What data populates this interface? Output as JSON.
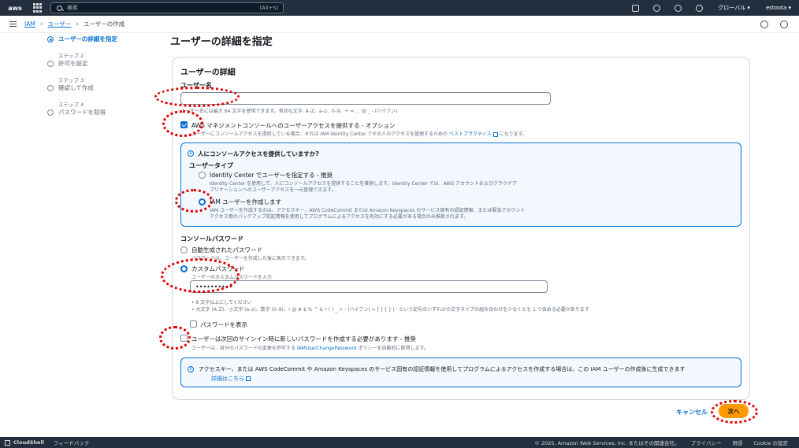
{
  "topnav": {
    "logo": "aws",
    "search_placeholder": "検索",
    "search_shortcut": "[Alt+S]",
    "region": "グローバル ▾",
    "account": "estoota ▾"
  },
  "breadcrumb": {
    "service": "IAM",
    "parent": "ユーザー",
    "current": "ユーザーの作成"
  },
  "steps": [
    {
      "num": "",
      "label": "ユーザーの詳細を指定"
    },
    {
      "num": "ステップ 2",
      "label": "許可を設定"
    },
    {
      "num": "ステップ 3",
      "label": "確認して作成"
    },
    {
      "num": "ステップ 4",
      "label": "パスワードを取得"
    }
  ],
  "page_title": "ユーザーの詳細を指定",
  "card": {
    "title": "ユーザーの詳細",
    "username_label": "ユーザー名",
    "username_hint": "ユーザー名には最大 64 文字を使用できます。有効な文字: A–Z、a–z、0–9、+ = , . @ _ - (ハイフン)",
    "console_access_label": "AWS マネジメントコンソールへのユーザーアクセスを提供する - オプション",
    "console_access_hint": "ユーザーにコンソールアクセスを提供している場合、それは IAM Identity Center でその人のアクセスを管理するための",
    "best_practice_link": "ベストプラクティス",
    "console_access_hint_tail": "になります。",
    "info_title": "人にコンソールアクセスを提供していますか?",
    "user_type_label": "ユーザータイプ",
    "opt_identity_center": "Identity Center でユーザーを指定する - 推奨",
    "opt_identity_center_hint1": "Identity Center を使用して、人にコンソールアクセスを提供することを推奨します。Identity Center では、AWS アカウントおよびクラウドア",
    "opt_identity_center_hint2": "プリケーションへのユーザーアクセスを一元管理できます。",
    "opt_iam_user": "IAM ユーザーを作成します",
    "opt_iam_user_hint1": "IAM ユーザーを作成するのは、アクセスキー、AWS CodeCommit または Amazon Keyspaces のサービス固有の認証情報、または緊急アカウント",
    "opt_iam_user_hint2": "アクセス用のバックアップ認証情報を使用してプログラムによるアクセスを有効にする必要がある場合のみ推奨されます。",
    "console_password_label": "コンソールパスワード",
    "opt_autogen": "自動生成されたパスワード",
    "opt_autogen_hint": "パスワードは、ユーザーを作成した後に表示できます。",
    "opt_custom": "カスタムパスワード",
    "opt_custom_hint": "ユーザーのカスタムパスワードを入力",
    "password_value": "••••••••••",
    "pw_rule1": "• 8 文字以上にしてください",
    "pw_rule2": "• 大文字 (A–Z)、小文字 (a–z)、数字 (0–9)、! @ # $ % ^ & * ( ) _ + - (ハイフン) = [ ] { } | ' という記号のいずれかの文字タイプの組み合わせを少なくとも 1 つ含める必要があります",
    "show_password": "パスワードを表示",
    "must_reset": "ユーザーは次回のサインイン時に新しいパスワードを作成する必要があります - 推奨",
    "must_reset_hint": "ユーザーは、自分のパスワードの変更を許可する",
    "policy_link": "IAMUserChangePassword",
    "must_reset_hint_tail": "ポリシーを自動的に取得します。",
    "bottom_info": "アクセスキー、または AWS CodeCommit や Amazon Keyspaces のサービス固有の認証情報を使用してプログラムによるアクセスを作成する場合は、この IAM ユーザーの作成後に生成できます",
    "learn_more": "詳細はこちら"
  },
  "actions": {
    "cancel": "キャンセル",
    "next": "次へ"
  },
  "footer": {
    "cloudshell": "CloudShell",
    "feedback": "フィードバック",
    "copyright": "© 2025, Amazon Web Services, Inc. またはその関連会社。",
    "privacy": "プライバシー",
    "terms": "用語",
    "cookie": "Cookie の設定"
  },
  "colors": {
    "nav_bg": "#232f3e",
    "link": "#0972d3",
    "primary_button": "#ff9900",
    "annotation": "#e00000"
  }
}
